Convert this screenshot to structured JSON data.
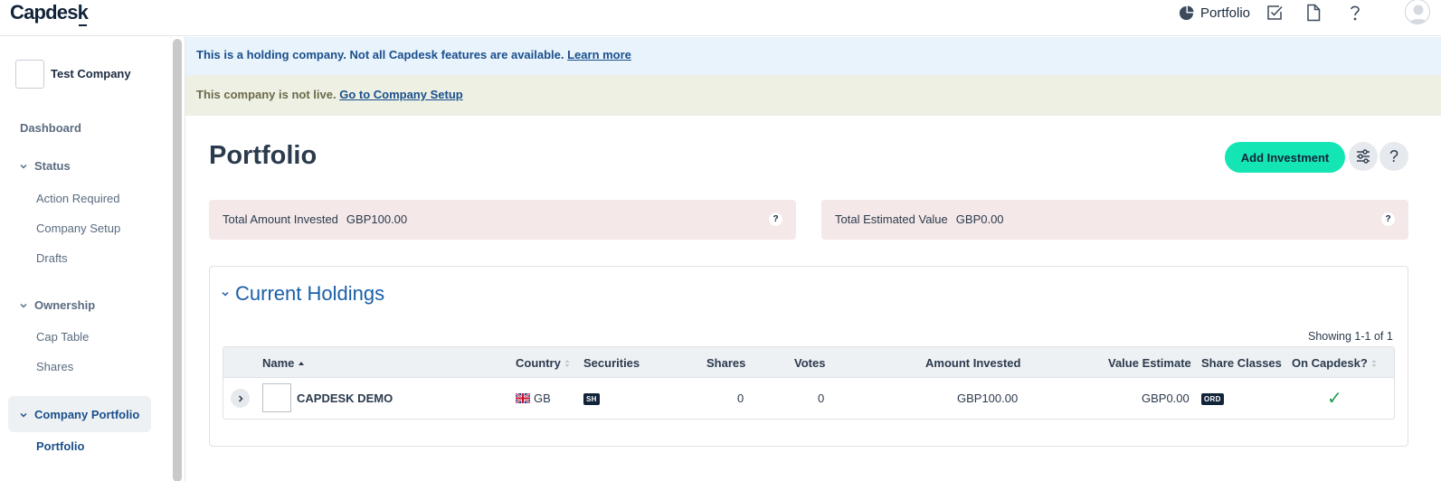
{
  "app": {
    "logo_prefix": "Capdes",
    "logo_k": "k"
  },
  "topnav": {
    "portfolio_label": "Portfolio",
    "icons": [
      "pie-chart-icon",
      "tasks-checkbox-icon",
      "document-icon",
      "help-icon",
      "user-avatar-icon"
    ]
  },
  "sidebar": {
    "company_name": "Test Company",
    "dashboard": "Dashboard",
    "status": {
      "label": "Status",
      "items": [
        "Action Required",
        "Company Setup",
        "Drafts"
      ]
    },
    "ownership": {
      "label": "Ownership",
      "items": [
        "Cap Table",
        "Shares"
      ]
    },
    "company_portfolio": {
      "label": "Company Portfolio",
      "items": [
        "Portfolio"
      ]
    }
  },
  "banners": {
    "holding_text": "This is a holding company. Not all Capdesk features are available. ",
    "holding_link": "Learn more",
    "live_text": "This company is not live. ",
    "live_link": "Go to Company Setup"
  },
  "page": {
    "title": "Portfolio",
    "add_investment_label": "Add Investment",
    "settings_icon": "sliders-icon",
    "help_label": "?"
  },
  "stats": {
    "invested_label": "Total Amount Invested",
    "invested_value": "GBP100.00",
    "estimated_label": "Total Estimated Value",
    "estimated_value": "GBP0.00",
    "help_label": "?"
  },
  "holdings": {
    "title": "Current Holdings",
    "showing": "Showing 1-1 of 1",
    "columns": [
      "Name",
      "Country",
      "Securities",
      "Shares",
      "Votes",
      "Amount Invested",
      "Value Estimate",
      "Share Classes",
      "On Capdesk?"
    ],
    "rows": [
      {
        "name": "CAPDESK DEMO",
        "country": "GB",
        "securities": "SH",
        "shares": "0",
        "votes": "0",
        "amount_invested": "GBP100.00",
        "value_estimate": "GBP0.00",
        "share_classes": "ORD",
        "on_capdesk": "✓"
      }
    ]
  },
  "colors": {
    "accent_button": "#13e5b4",
    "link_blue": "#1a4f8c",
    "banner_blue_bg": "#e8f3fc",
    "banner_yellow_bg": "#eef0e3",
    "stat_card_bg": "#f4e8e8",
    "check_green": "#1f9d55"
  }
}
